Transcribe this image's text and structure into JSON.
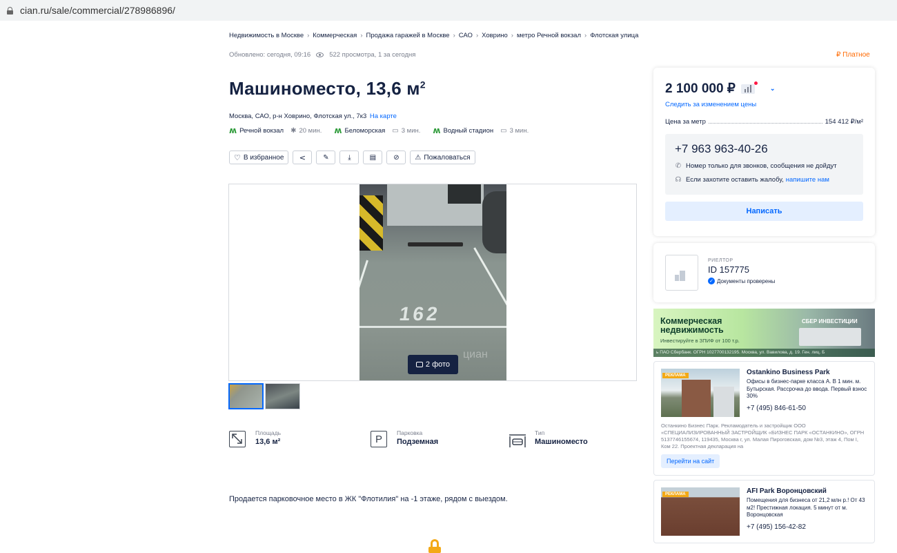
{
  "browser": {
    "url": "cian.ru/sale/commercial/278986896/"
  },
  "breadcrumbs": [
    "Недвижимость в Москве",
    "Коммерческая",
    "Продажа гаражей в Москве",
    "САО",
    "Ховрино",
    "метро Речной вокзал",
    "Флотская улица"
  ],
  "meta": {
    "updated": "Обновлено: сегодня, 09:16",
    "views": "522 просмотра, 1 за сегодня",
    "paid_label": "₽ Платное"
  },
  "listing": {
    "title": "Машиноместо, 13,6 м",
    "title_sup": "2",
    "address": "Москва, САО, р-н Ховрино, Флотская ул., 7к3",
    "map_link": "На карте",
    "metros": [
      {
        "name": "Речной вокзал",
        "time": "20 мин.",
        "mode": "walk"
      },
      {
        "name": "Беломорская",
        "time": "3 мин.",
        "mode": "car"
      },
      {
        "name": "Водный стадион",
        "time": "3 мин.",
        "mode": "car"
      }
    ],
    "actions": {
      "favorite": "В избранное",
      "complain": "Пожаловаться"
    },
    "gallery": {
      "photo_count_label": "2 фото",
      "spot_number": "162",
      "watermark": "циан"
    },
    "features": [
      {
        "label": "Площадь",
        "value": "13,6 м²",
        "icon": "area-icon"
      },
      {
        "label": "Парковка",
        "value": "Подземная",
        "icon": "parking-icon"
      },
      {
        "label": "Тип",
        "value": "Машиноместо",
        "icon": "garage-icon"
      }
    ],
    "description": "Продается парковочное место в ЖК \"Флотилия\"  на -1 этаже, рядом с выездом."
  },
  "price_card": {
    "price": "2 100 000 ₽",
    "follow_price": "Следить за изменением цены",
    "price_per_meter_label": "Цена за метр",
    "price_per_meter_value": "154 412 ₽/м²",
    "phone": "+7 963 963-40-26",
    "note_calls": "Номер только для звонков, сообщения не дойдут",
    "note_complain": "Если захотите оставить жалобу,",
    "note_complain_link": "напишите нам",
    "write_button": "Написать"
  },
  "realtor": {
    "role": "РИЕЛТОР",
    "id": "ID 157775",
    "verified": "Документы проверены"
  },
  "banner": {
    "title_line1": "Коммерческая",
    "title_line2": "недвижимость",
    "subtitle": "Инвестируйте в ЗПИФ от 100 т.р.",
    "brand": "СБЕР ИНВЕСТИЦИИ",
    "footer": "ь ПАО Сбербанк. ОГРН 1027700132195. Москва, ул. Вавилова, д. 19. Ген. лиц. Б"
  },
  "ads": [
    {
      "tag": "РЕКЛАМА",
      "title": "Ostankino Business Park",
      "text": "Офисы в бизнес-парке класса А. В 1 мин. м. Бутырская. Рассрочка до ввода. Первый взнос 30%",
      "phone": "+7 (495) 846-61-50",
      "legal": "Останкино Бизнес Парк. Рекламодатель и застройщик ООО «СПЕЦИАЛИЗИРОВАННЫЙ ЗАСТРОЙЩИК «БИЗНЕС ПАРК «ОСТАНКИНО», ОГРН 5137746155674, 119435, Москва г, ул. Малая Пироговская, дом №3, этаж 4, Пом I, Ком 22. Проектная декларация на",
      "go": "Перейти на сайт"
    },
    {
      "tag": "РЕКЛАМА",
      "title": "AFI Park Воронцовский",
      "text": "Помещения для бизнеса от 21,2 млн р.! От 43 м2! Престижная локация. 5 минут от м. Воронцовская",
      "phone": "+7 (495) 156-42-82"
    }
  ]
}
